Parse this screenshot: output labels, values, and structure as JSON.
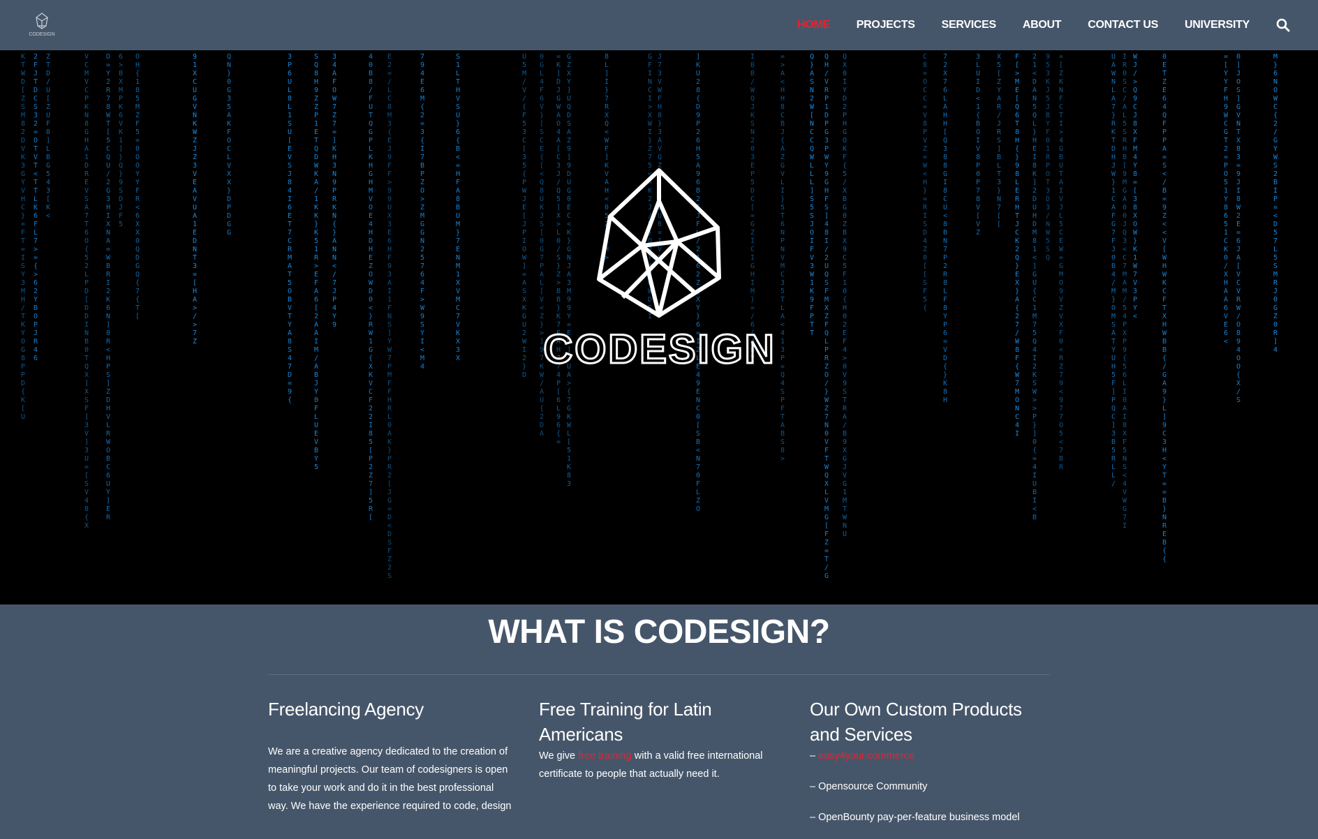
{
  "nav": {
    "logo_icon": "codesign-cube-logo",
    "logo_text": "CODESIGN",
    "items": [
      {
        "label": "HOME",
        "active": true
      },
      {
        "label": "PROJECTS",
        "active": false
      },
      {
        "label": "SERVICES",
        "active": false
      },
      {
        "label": "ABOUT",
        "active": false
      },
      {
        "label": "CONTACT US",
        "active": false
      },
      {
        "label": "UNIVERSITY",
        "active": false
      }
    ],
    "search_icon": "search-icon"
  },
  "hero": {
    "background": "matrix-code-rain",
    "logo_text": "CODESIGN"
  },
  "about": {
    "title": "WHAT IS CODESIGN?",
    "columns": [
      {
        "heading": "Freelancing Agency",
        "text": "We are a creative agency dedicated to the creation of meaningful projects. Our team of codesigners is open to take your work and do it in the best professional way. We have the experience required to code, design"
      },
      {
        "heading": "Free Training for Latin Americans",
        "text_before": "We give ",
        "link": "free training",
        "text_after": " with a valid free international certificate to people that actually need it."
      },
      {
        "heading": "Our Own Custom Products and Services",
        "items": [
          {
            "prefix": "– ",
            "link": "easy4your.commerce",
            "text": ""
          },
          {
            "prefix": "– ",
            "link": "",
            "text": "Opensource Community"
          },
          {
            "prefix": "– ",
            "link": "",
            "text": "OpenBounty pay-per-feature business model"
          }
        ]
      }
    ]
  },
  "colors": {
    "nav_bg": "#46566a",
    "accent": "#e8232e",
    "hero_bg": "#000000",
    "rain": "#1a8fe8"
  }
}
